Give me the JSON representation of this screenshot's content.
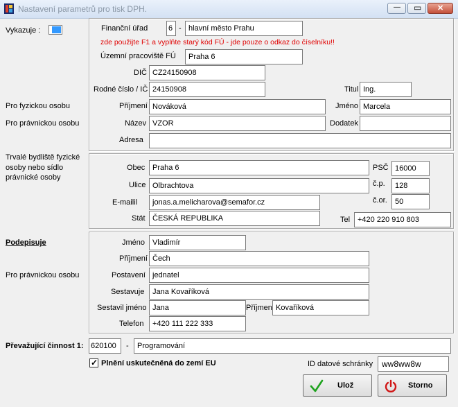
{
  "window": {
    "title": "Nastavení parametrů pro tisk DPH.",
    "minimize_symbol": "—",
    "maximize_symbol": "▭",
    "close_symbol": "✕"
  },
  "vykazuje": {
    "label": "Vykazuje :"
  },
  "section_labels": {
    "fyzicka": "Pro fyzickou osobu",
    "pravnicka": "Pro právnickou osobu",
    "bydliste": [
      "Trvalé bydliště fyzické",
      "osoby nebo sídlo",
      "právnické osoby"
    ],
    "podepisuje": "Podepisuje",
    "pravnicka2": "Pro právnickou osobu"
  },
  "taxpayer": {
    "financni_urad_label": "Finanční úřad",
    "financni_urad_code": "6",
    "financni_urad_name": "hlavní město Prahu",
    "note": "zde použijte F1 a vyplňte starý kód FÚ - jde pouze o odkaz do číselníku!!",
    "uzemni_label": "Územní pracoviště FÚ",
    "uzemni_value": "Praha 6",
    "dic_label": "DIČ",
    "dic_value": "CZ24150908",
    "rc_label": "Rodné číslo / IČ",
    "rc_value": "24150908",
    "titul_label": "Titul",
    "titul_value": "Ing.",
    "prijmeni_label": "Příjmení",
    "prijmeni_value": "Nováková",
    "jmeno_label": "Jméno",
    "jmeno_value": "Marcela",
    "nazev_label": "Název",
    "nazev_value": "VZOR",
    "dodatek_label": "Dodatek",
    "dodatek_value": "",
    "adresa_label": "Adresa",
    "adresa_value": ""
  },
  "address": {
    "obec_label": "Obec",
    "obec_value": "Praha 6",
    "psc_label": "PSČ",
    "psc_value": "16000",
    "ulice_label": "Ulice",
    "ulice_value": "Olbrachtova",
    "cp_label": "č.p.",
    "cp_value": "128",
    "email_label": "E-mailil",
    "email_value": "jonas.a.melicharova@semafor.cz",
    "cor_label": "č.or.",
    "cor_value": "50",
    "stat_label": "Stát",
    "stat_value": "ČESKÁ REPUBLIKA",
    "tel_label": "Tel",
    "tel_value": "+420 220 910 803"
  },
  "signer": {
    "jmeno_label": "Jméno",
    "jmeno_value": "Vladimír",
    "prijmeni_label": "Příjmení",
    "prijmeni_value": "Čech",
    "postaveni_label": "Postavení",
    "postaveni_value": "jednatel",
    "sestavuje_label": "Sestavuje",
    "sestavuje_value": "Jana Kovaříková",
    "sestavil_label": "Sestavil jméno",
    "sestavil_value": "Jana",
    "sestavil_prijmeni_label": "Příjmení",
    "sestavil_prijmeni_value": "Kovaříková",
    "telefon_label": "Telefon",
    "telefon_value": "+420 111 222 333"
  },
  "activity": {
    "label": "Převažující činnost 1:",
    "code": "620100",
    "dash": "-",
    "name": "Programování"
  },
  "eu_checkbox": {
    "label": "Plnění uskutečněná do zemí EU",
    "checked": true,
    "mark": "✓"
  },
  "datova_schranka": {
    "label": "ID datové schránky",
    "value": "ww8ww8w"
  },
  "buttons": {
    "ok": {
      "label": "Ulož",
      "icon": "check-icon"
    },
    "cancel": {
      "label": "Storno",
      "icon": "power-icon"
    }
  },
  "code_dash": "-"
}
